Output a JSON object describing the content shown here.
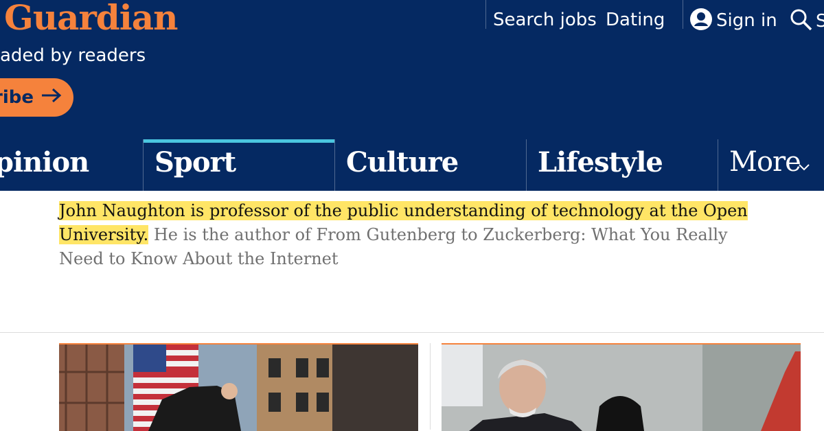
{
  "header": {
    "logo": "Guardian",
    "tagline": "aded by readers",
    "subscribe_label": "ribe",
    "links": [
      "Search jobs",
      "Dating"
    ],
    "signin_label": "Sign in",
    "search_label": "S"
  },
  "nav": {
    "items": [
      {
        "label": "pinion"
      },
      {
        "label": "Sport"
      },
      {
        "label": "Culture"
      },
      {
        "label": "Lifestyle"
      },
      {
        "label": "More"
      }
    ]
  },
  "bio": {
    "highlighted": "John Naughton is professor of the public understanding of technology at the Open University.",
    "rest": " He is the author of From Gutenberg to Zuckerberg: What You Really Need to Know About the Internet"
  },
  "colors": {
    "brand_blue": "#052962",
    "brand_orange": "#f5823c",
    "active_tab": "#4bc6df",
    "highlight": "#ffe566"
  },
  "icons": [
    "arrow-right-icon",
    "user-icon",
    "search-icon",
    "chevron-down-icon"
  ]
}
